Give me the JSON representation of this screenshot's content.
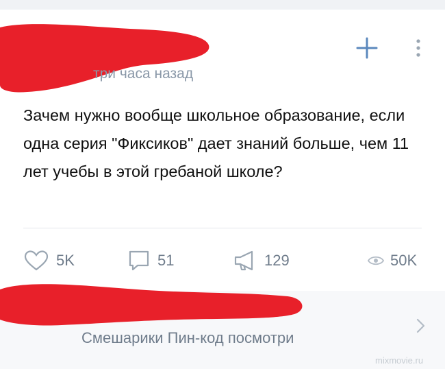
{
  "post": {
    "timestamp": "три часа назад",
    "text": "Зачем нужно вообще школьное образование, если одна серия \"Фиксиков\" дает знаний больше, чем 11 лет учебы в этой гребаной школе?",
    "likes": "5K",
    "comments": "51",
    "reposts": "129",
    "views": "50K"
  },
  "repost": {
    "title": "Смешарики Пин-код посмотри"
  },
  "watermark": "mixmovie.ru",
  "icons": {
    "add": "plus-icon",
    "more": "vertical-dots-icon",
    "like": "heart-icon",
    "comment": "comment-bubble-icon",
    "share": "megaphone-icon",
    "views": "eye-icon",
    "open": "chevron-right-icon"
  },
  "colors": {
    "accent": "#5b88bd",
    "muted_text": "#6f7c8b",
    "redaction": "#e8202a"
  }
}
